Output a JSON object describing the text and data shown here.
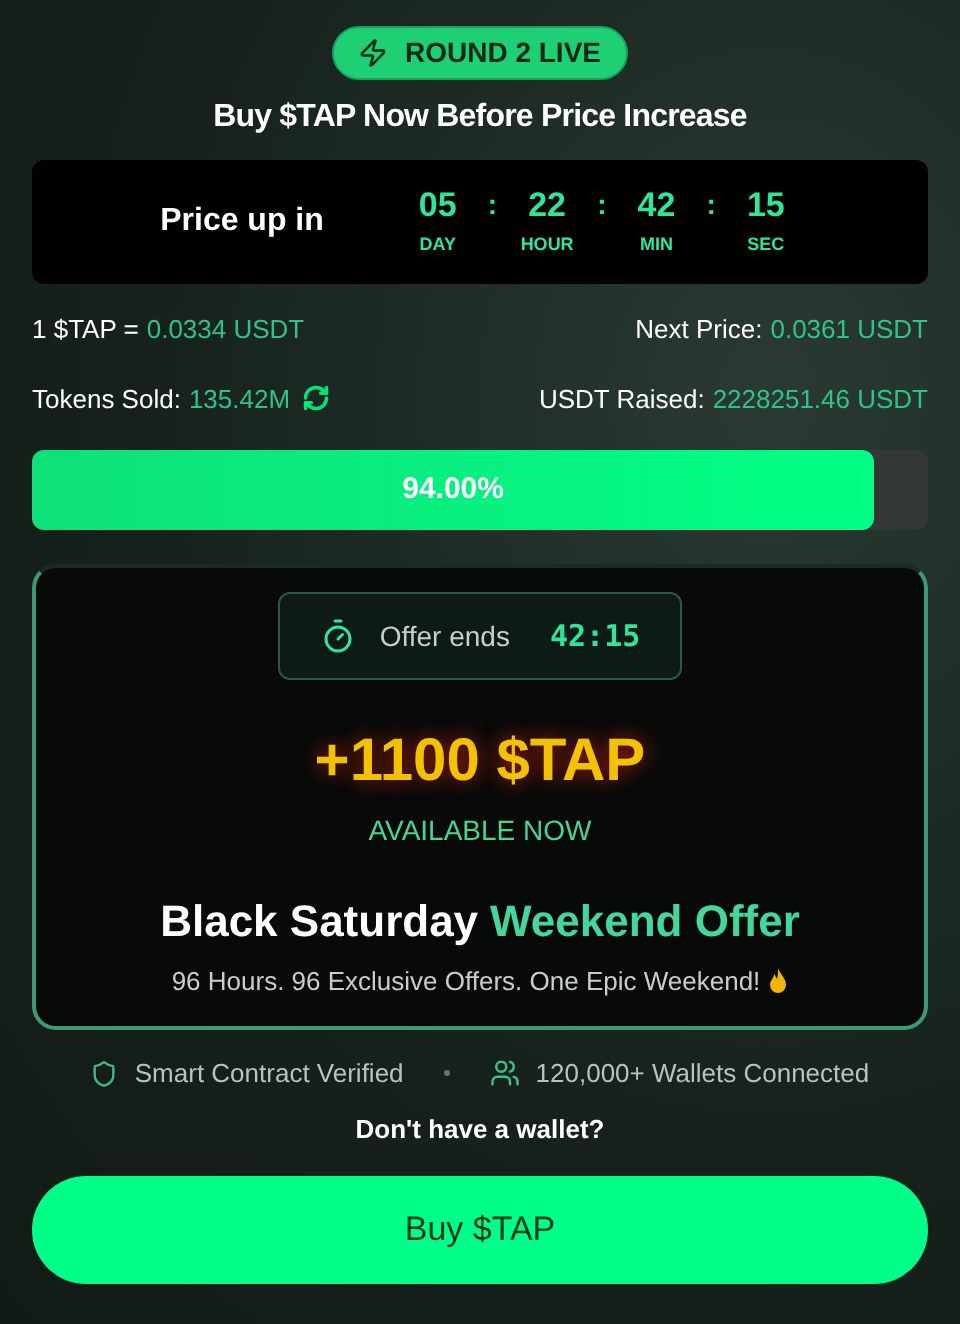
{
  "badge": "ROUND 2 LIVE",
  "title": "Buy $TAP Now Before Price Increase",
  "countdown": {
    "label": "Price up in",
    "units": [
      {
        "value": "05",
        "unit": "DAY"
      },
      {
        "value": "22",
        "unit": "HOUR"
      },
      {
        "value": "42",
        "unit": "MIN"
      },
      {
        "value": "15",
        "unit": "SEC"
      }
    ],
    "separator": ":"
  },
  "stats": [
    {
      "label": "1 $TAP =",
      "value": "0.0334 USDT"
    },
    {
      "label": "Next Price:",
      "value": "0.0361 USDT"
    },
    {
      "label": "Tokens Sold:",
      "value": "135.42M"
    },
    {
      "label": "USDT Raised:",
      "value": "2228251.46 USDT"
    }
  ],
  "progress": {
    "level": 0.94,
    "label": "94.00%"
  },
  "offer": {
    "timer_label": "Offer ends",
    "timer_value": "42:15",
    "bonus": "+1100 $TAP",
    "availability": "AVAILABLE NOW",
    "headline": "Black Saturday",
    "headline_highlight": "Weekend Offer",
    "subtitle": "96 Hours. 96 Exclusive Offers. One Epic Weekend!"
  },
  "trust": [
    "Smart Contract Verified",
    "120,000+ Wallets Connected"
  ],
  "wallet_prompt": "Don't have a wallet?",
  "buy_button": "Buy $TAP"
}
